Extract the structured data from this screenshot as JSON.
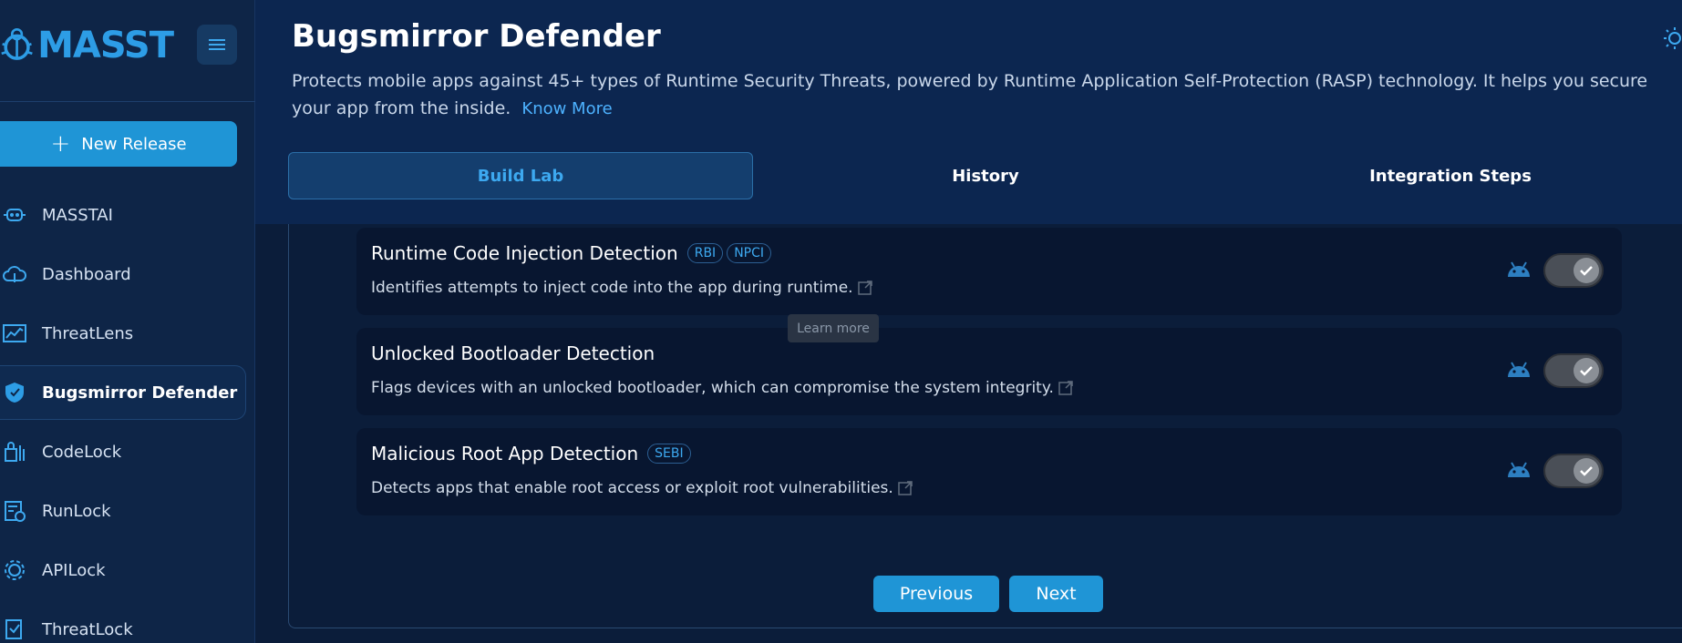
{
  "sidebar": {
    "logo_text": "MASST",
    "new_release_label": "New Release",
    "items": [
      {
        "label": "MASSTAI",
        "icon": "robot-icon"
      },
      {
        "label": "Dashboard",
        "icon": "cloud-icon"
      },
      {
        "label": "ThreatLens",
        "icon": "chart-icon"
      },
      {
        "label": "Bugsmirror Defender",
        "icon": "shield-icon",
        "active": true
      },
      {
        "label": "CodeLock",
        "icon": "code-lock-icon"
      },
      {
        "label": "RunLock",
        "icon": "run-lock-icon"
      },
      {
        "label": "APILock",
        "icon": "api-gear-icon"
      },
      {
        "label": "ThreatLock",
        "icon": "threat-lock-icon"
      }
    ]
  },
  "header": {
    "title": "Bugsmirror Defender",
    "description": "Protects mobile apps against 45+ types of Runtime Security Threats, powered by Runtime Application Self-Protection (RASP) technology. It helps you secure your app from the inside.",
    "know_more_label": "Know More"
  },
  "tabs": [
    {
      "label": "Build Lab",
      "active": true
    },
    {
      "label": "History"
    },
    {
      "label": "Integration Steps"
    }
  ],
  "features": [
    {
      "title": "Runtime Code Injection Detection",
      "badges": [
        "RBI",
        "NPCI"
      ],
      "description": "Identifies attempts to inject code into the app during runtime.",
      "enabled": true
    },
    {
      "title": "Unlocked Bootloader Detection",
      "badges": [],
      "description": "Flags devices with an unlocked bootloader, which can compromise the system integrity.",
      "enabled": true
    },
    {
      "title": "Malicious Root App Detection",
      "badges": [
        "SEBI"
      ],
      "description": "Detects apps that enable root access or exploit root vulnerabilities.",
      "enabled": true
    }
  ],
  "tooltip": "Learn more",
  "pagination": {
    "previous_label": "Previous",
    "next_label": "Next"
  },
  "colors": {
    "accent": "#1f95d6",
    "link": "#4db2ff",
    "background": "#0b1d3a"
  }
}
